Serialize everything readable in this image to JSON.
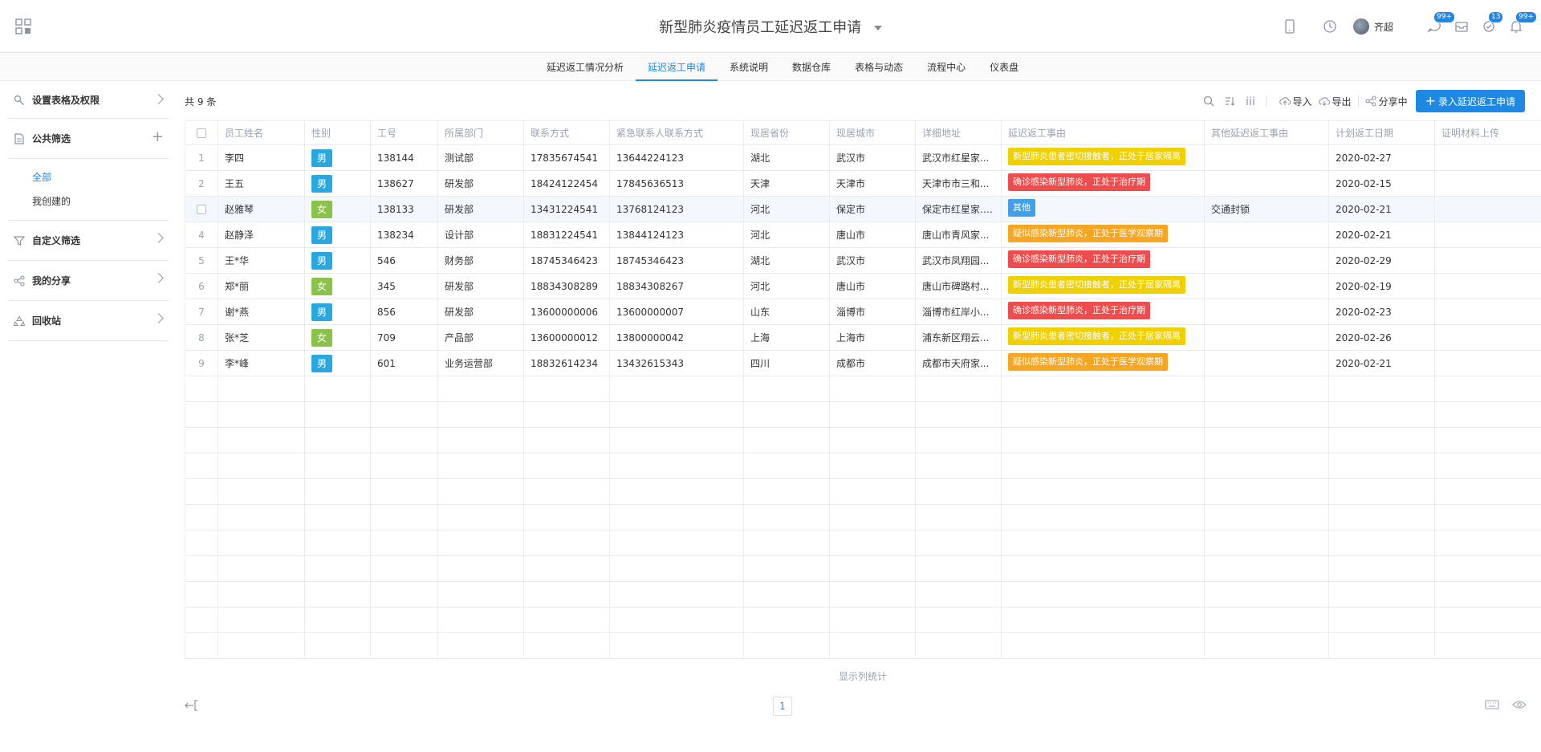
{
  "header": {
    "title": "新型肺炎疫情员工延迟返工申请",
    "user_name": "齐超",
    "badges": [
      "99+",
      "13",
      "99+"
    ]
  },
  "nav": {
    "tabs": [
      {
        "label": "延迟返工情况分析",
        "active": false
      },
      {
        "label": "延迟返工申请",
        "active": true
      },
      {
        "label": "系统说明",
        "active": false
      },
      {
        "label": "数据仓库",
        "active": false
      },
      {
        "label": "表格与动态",
        "active": false
      },
      {
        "label": "流程中心",
        "active": false
      },
      {
        "label": "仪表盘",
        "active": false
      }
    ]
  },
  "sidebar": {
    "settings_label": "设置表格及权限",
    "public_filter_label": "公共筛选",
    "sub_items": [
      {
        "label": "全部",
        "active": true
      },
      {
        "label": "我创建的",
        "active": false
      }
    ],
    "custom_filter_label": "自定义筛选",
    "my_share_label": "我的分享",
    "recycle_label": "回收站"
  },
  "toolbar": {
    "count_text": "共 9 条",
    "import_label": "导入",
    "export_label": "导出",
    "share_label": "分享中",
    "add_button_label": "录入延迟返工申请"
  },
  "colors": {
    "accent": "#1e88e5",
    "male": "#29a8e0",
    "female": "#8bc34a",
    "tag_yellow": "#f0d000",
    "tag_red": "#ef4d4d",
    "tag_orange": "#f6a623",
    "tag_blue": "#3ea1ea"
  },
  "table": {
    "columns": [
      "员工姓名",
      "性别",
      "工号",
      "所属部门",
      "联系方式",
      "紧急联系人联系方式",
      "现居省份",
      "现居城市",
      "详细地址",
      "延迟返工事由",
      "其他延迟返工事由",
      "计划返工日期",
      "证明材料上传"
    ],
    "rows": [
      {
        "num": "1",
        "name": "李四",
        "gender": "男",
        "id": "138144",
        "dept": "测试部",
        "phone": "17835674541",
        "emergency": "13644224123",
        "province": "湖北",
        "city": "武汉市",
        "address": "武汉市红星家...",
        "reason": "新型肺炎患者密切接触者，正处于居家隔离",
        "reason_color": "yellow",
        "other_reason": "",
        "date": "2020-02-27",
        "proof": ""
      },
      {
        "num": "2",
        "name": "王五",
        "gender": "男",
        "id": "138627",
        "dept": "研发部",
        "phone": "18424122454",
        "emergency": "17845636513",
        "province": "天津",
        "city": "天津市",
        "address": "天津市市三和...",
        "reason": "确诊感染新型肺炎，正处于治疗期",
        "reason_color": "red",
        "other_reason": "",
        "date": "2020-02-15",
        "proof": ""
      },
      {
        "num": "",
        "name": "赵雅琴",
        "gender": "女",
        "id": "138133",
        "dept": "研发部",
        "phone": "13431224541",
        "emergency": "13768124123",
        "province": "河北",
        "city": "保定市",
        "address": "保定市红星家...",
        "reason": "其他",
        "reason_color": "blue",
        "other_reason": "交通封锁",
        "date": "2020-02-21",
        "proof": ""
      },
      {
        "num": "4",
        "name": "赵静泽",
        "gender": "男",
        "id": "138234",
        "dept": "设计部",
        "phone": "18831224541",
        "emergency": "13844124123",
        "province": "河北",
        "city": "唐山市",
        "address": "唐山市青风家...",
        "reason": "疑似感染新型肺炎，正处于医学观察期",
        "reason_color": "orange",
        "other_reason": "",
        "date": "2020-02-21",
        "proof": ""
      },
      {
        "num": "5",
        "name": "王*华",
        "gender": "男",
        "id": "546",
        "dept": "财务部",
        "phone": "18745346423",
        "emergency": "18745346423",
        "province": "湖北",
        "city": "武汉市",
        "address": "武汉市凤翔园...",
        "reason": "确诊感染新型肺炎，正处于治疗期",
        "reason_color": "red",
        "other_reason": "",
        "date": "2020-02-29",
        "proof": ""
      },
      {
        "num": "6",
        "name": "郑*丽",
        "gender": "女",
        "id": "345",
        "dept": "研发部",
        "phone": "18834308289",
        "emergency": "18834308267",
        "province": "河北",
        "city": "唐山市",
        "address": "唐山市碑路村...",
        "reason": "新型肺炎患者密切接触者，正处于居家隔离",
        "reason_color": "yellow",
        "other_reason": "",
        "date": "2020-02-19",
        "proof": ""
      },
      {
        "num": "7",
        "name": "谢*燕",
        "gender": "男",
        "id": "856",
        "dept": "研发部",
        "phone": "13600000006",
        "emergency": "13600000007",
        "province": "山东",
        "city": "淄博市",
        "address": "淄博市红岸小...",
        "reason": "确诊感染新型肺炎，正处于治疗期",
        "reason_color": "red",
        "other_reason": "",
        "date": "2020-02-23",
        "proof": ""
      },
      {
        "num": "8",
        "name": "张*芝",
        "gender": "女",
        "id": "709",
        "dept": "产品部",
        "phone": "13600000012",
        "emergency": "13800000042",
        "province": "上海",
        "city": "上海市",
        "address": "浦东新区翔云...",
        "reason": "新型肺炎患者密切接触者，正处于居家隔离",
        "reason_color": "yellow",
        "other_reason": "",
        "date": "2020-02-26",
        "proof": ""
      },
      {
        "num": "9",
        "name": "李*峰",
        "gender": "男",
        "id": "601",
        "dept": "业务运营部",
        "phone": "18832614234",
        "emergency": "13432615343",
        "province": "四川",
        "city": "成都市",
        "address": "成都市天府家...",
        "reason": "疑似感染新型肺炎，正处于医学观察期",
        "reason_color": "orange",
        "other_reason": "",
        "date": "2020-02-21",
        "proof": ""
      }
    ],
    "empty_rows": 11
  },
  "footer": {
    "stats_label": "显示列统计",
    "page": "1"
  }
}
